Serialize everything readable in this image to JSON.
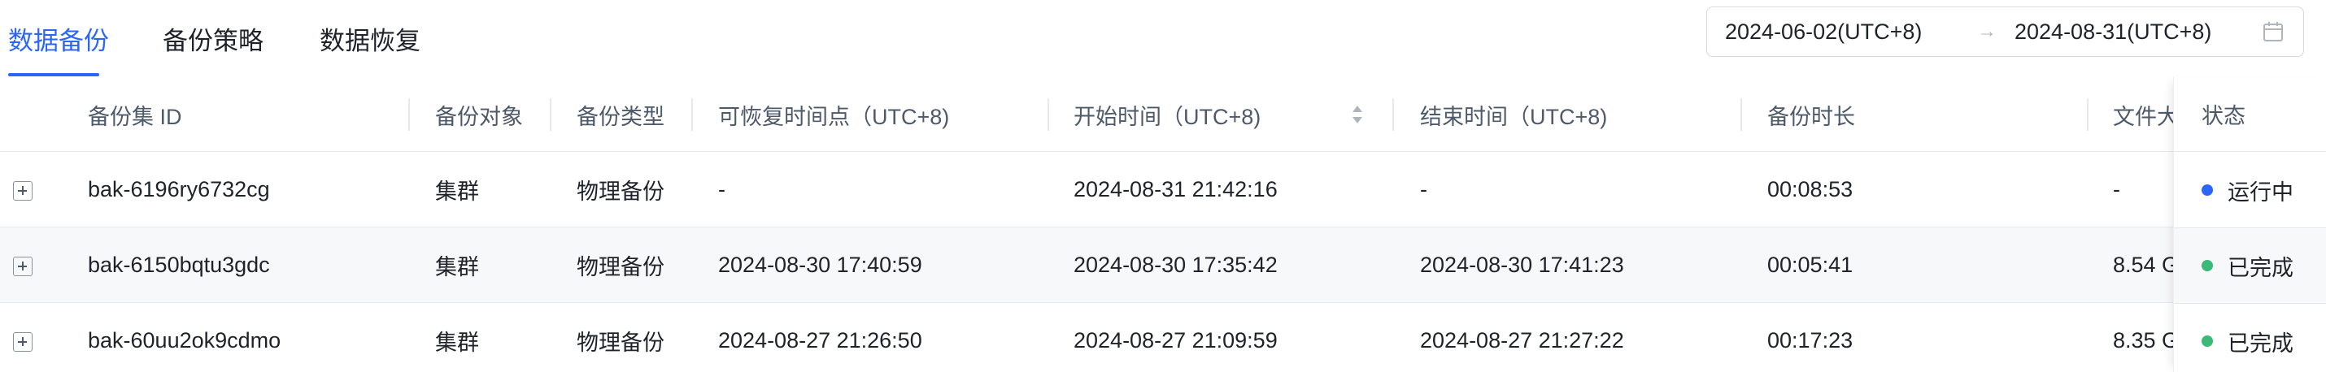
{
  "tabs": [
    {
      "label": "数据备份",
      "active": true
    },
    {
      "label": "备份策略",
      "active": false
    },
    {
      "label": "数据恢复",
      "active": false
    }
  ],
  "date_range": {
    "start": "2024-06-02(UTC+8)",
    "separator": "→",
    "end": "2024-08-31(UTC+8)",
    "icon": "calendar-icon"
  },
  "table": {
    "headers": {
      "backup_id": "备份集 ID",
      "target": "备份对象",
      "type": "备份类型",
      "restore_point": "可恢复时间点（UTC+8)",
      "start_time": "开始时间（UTC+8)",
      "end_time": "结束时间（UTC+8)",
      "duration": "备份时长",
      "file_size": "文件大",
      "status": "状态"
    },
    "rows": [
      {
        "backup_id": "bak-6196ry6732cg",
        "target": "集群",
        "type": "物理备份",
        "restore_point": "-",
        "start_time": "2024-08-31 21:42:16",
        "end_time": "-",
        "duration": "00:08:53",
        "file_size": "-",
        "status": "运行中",
        "status_color": "#2b66f6"
      },
      {
        "backup_id": "bak-6150bqtu3gdc",
        "target": "集群",
        "type": "物理备份",
        "restore_point": "2024-08-30 17:40:59",
        "start_time": "2024-08-30 17:35:42",
        "end_time": "2024-08-30 17:41:23",
        "duration": "00:05:41",
        "file_size": "8.54 G",
        "status": "已完成",
        "status_color": "#3bb977"
      },
      {
        "backup_id": "bak-60uu2ok9cdmo",
        "target": "集群",
        "type": "物理备份",
        "restore_point": "2024-08-27 21:26:50",
        "start_time": "2024-08-27 21:09:59",
        "end_time": "2024-08-27 21:27:22",
        "duration": "00:17:23",
        "file_size": "8.35 G",
        "status": "已完成",
        "status_color": "#3bb977"
      }
    ]
  },
  "colors": {
    "accent": "#2b66f6",
    "running": "#2b66f6",
    "completed": "#3bb977"
  }
}
